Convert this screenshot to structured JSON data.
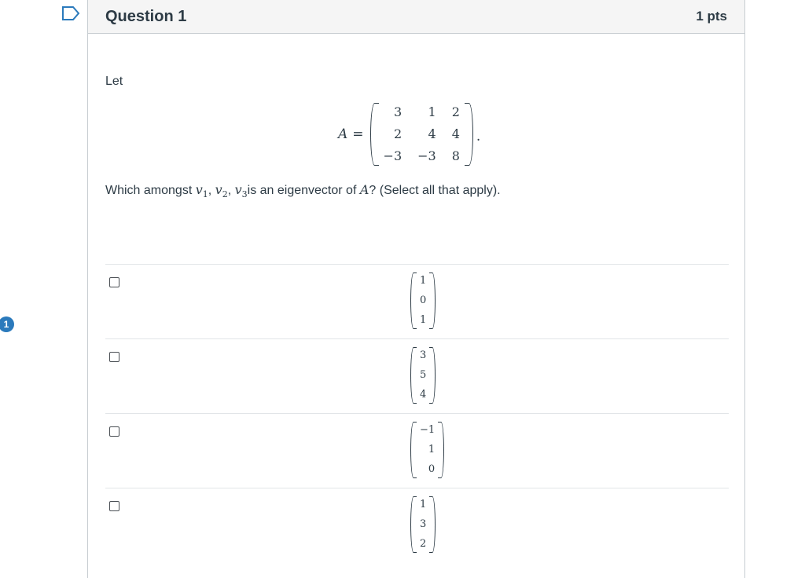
{
  "header": {
    "title": "Question 1",
    "points": "1 pts"
  },
  "side_badge": "1",
  "question": {
    "intro": "Let",
    "matrix": {
      "name": "A",
      "equals": "=",
      "rows": [
        [
          "3",
          "1",
          "2"
        ],
        [
          "2",
          "4",
          "4"
        ],
        [
          "−3",
          "−3",
          "8"
        ]
      ],
      "trailing": "."
    },
    "prompt": {
      "prefix": "Which amongst ",
      "vectors": [
        {
          "var": "v",
          "sub": "1"
        },
        {
          "var": "v",
          "sub": "2"
        },
        {
          "var": "v",
          "sub": "3"
        }
      ],
      "middle": "is an eigenvector of ",
      "matrix_name": "A",
      "suffix": "? (Select all that apply)."
    }
  },
  "answers": [
    {
      "vector": [
        "1",
        "0",
        "1"
      ],
      "checked": false
    },
    {
      "vector": [
        "3",
        "5",
        "4"
      ],
      "checked": false
    },
    {
      "vector": [
        "−1",
        "1",
        "0"
      ],
      "checked": false
    },
    {
      "vector": [
        "1",
        "3",
        "2"
      ],
      "checked": false
    }
  ],
  "colors": {
    "accent": "#2b7abc",
    "text": "#2d3b45",
    "header_bg": "#f5f5f5",
    "border": "#c7cdd1"
  }
}
